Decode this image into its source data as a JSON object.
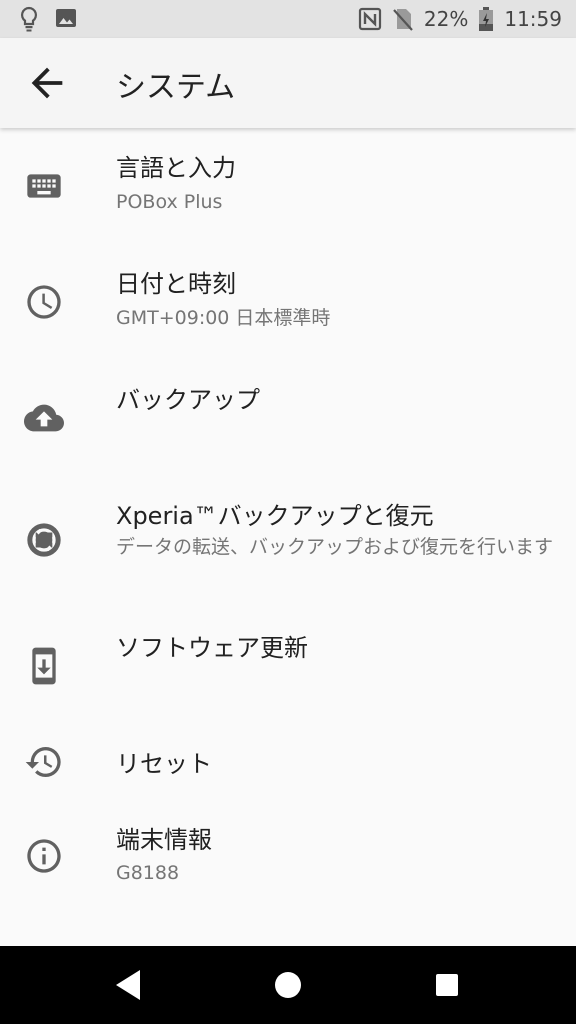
{
  "status_bar": {
    "battery": "22%",
    "time": "11:59",
    "icons": [
      "lightbulb-icon",
      "image-icon",
      "nfc-icon",
      "no-sim-icon",
      "battery-charging-icon"
    ]
  },
  "app_bar": {
    "title": "システム",
    "back_icon": "arrow-back-icon"
  },
  "items": [
    {
      "icon": "keyboard-icon",
      "title": "言語と入力",
      "subtitle": "POBox Plus"
    },
    {
      "icon": "clock-icon",
      "title": "日付と時刻",
      "subtitle": "GMT+09:00 日本標準時"
    },
    {
      "icon": "cloud-upload-icon",
      "title": "バックアップ",
      "subtitle": ""
    },
    {
      "icon": "xperia-transfer-icon",
      "title": "Xperia™バックアップと復元",
      "subtitle": "データの転送、バックアップおよび復元を行います"
    },
    {
      "icon": "system-update-icon",
      "title": "ソフトウェア更新",
      "subtitle": ""
    },
    {
      "icon": "restore-icon",
      "title": "リセット",
      "subtitle": ""
    },
    {
      "icon": "info-icon",
      "title": "端末情報",
      "subtitle": "G8188"
    }
  ],
  "nav_bar": {
    "icons": [
      "back-triangle-icon",
      "home-circle-icon",
      "recents-square-icon"
    ]
  },
  "colors": {
    "background": "#fafafa",
    "status_bar": "#e3e3e3",
    "icon": "#616161",
    "title": "#212121",
    "subtitle": "#757575"
  }
}
